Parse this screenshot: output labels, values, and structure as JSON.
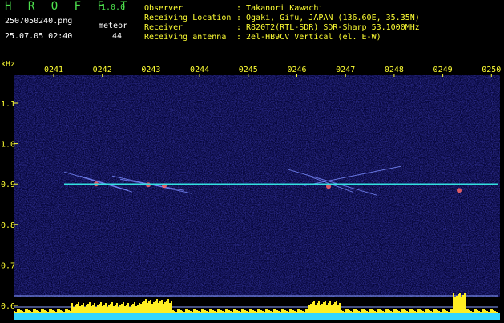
{
  "header": {
    "app_name": "H R O F F T",
    "version": "1.0.0",
    "filename": "2507050240.png",
    "datetime": "25.07.05 02:40",
    "meteor_label": "meteor",
    "meteor_count": "44",
    "info_labels": [
      "Observer",
      "Receiving Location",
      "Receiver",
      "Receiving antenna"
    ],
    "info_values": [
      ": Takanori Kawachi",
      ": Ogaki, Gifu, JAPAN (136.60E, 35.35N)",
      ": R820T2(RTL-SDR) SDR-Sharp 53.1000MHz",
      ": 2el-HB9CV Vertical (el. E-W)"
    ]
  },
  "spectrogram": {
    "y_unit": "kHz",
    "time_labels": [
      "0241",
      "0242",
      "0243",
      "0244",
      "0245",
      "0246",
      "0247",
      "0248",
      "0249",
      "0250"
    ],
    "freq_labels": [
      "1.1",
      "1.0",
      "0.9",
      "0.8",
      "0.7",
      "0.6"
    ]
  },
  "colors": {
    "background": "#000000",
    "noise": "#0a0a55",
    "carrier": "#33e0e0",
    "text_green": "#4de04d",
    "text_yellow": "#ffff33",
    "baseline": "#33d6ff",
    "echo": "#ff6666"
  }
}
